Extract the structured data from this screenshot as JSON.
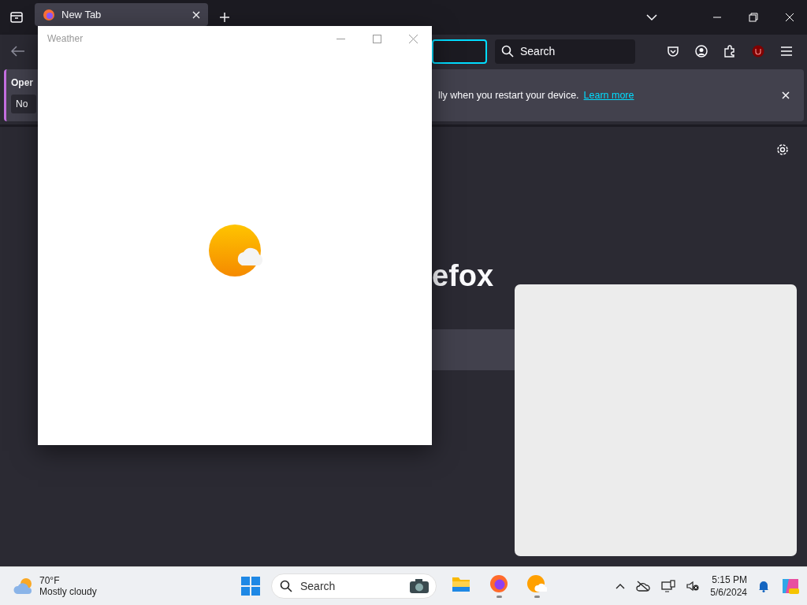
{
  "browser": {
    "tabs": [
      {
        "label": "New Tab",
        "selected": true
      }
    ],
    "search": {
      "placeholder": "Search"
    },
    "notification": {
      "title": "Oper",
      "button": "No",
      "message": "lly when you restart your device.",
      "link": "Learn more"
    },
    "new_tab": {
      "logo_text": "efox"
    }
  },
  "weather_window": {
    "title": "Weather"
  },
  "taskbar": {
    "weather": {
      "temperature": "70°F",
      "condition": "Mostly cloudy"
    },
    "search": {
      "placeholder": "Search"
    },
    "apps": [
      {
        "kind": "files",
        "running": false
      },
      {
        "kind": "firefox",
        "running": true
      },
      {
        "kind": "weather",
        "running": true
      }
    ],
    "clock": {
      "time": "5:15 PM",
      "date": "5/6/2024"
    }
  }
}
